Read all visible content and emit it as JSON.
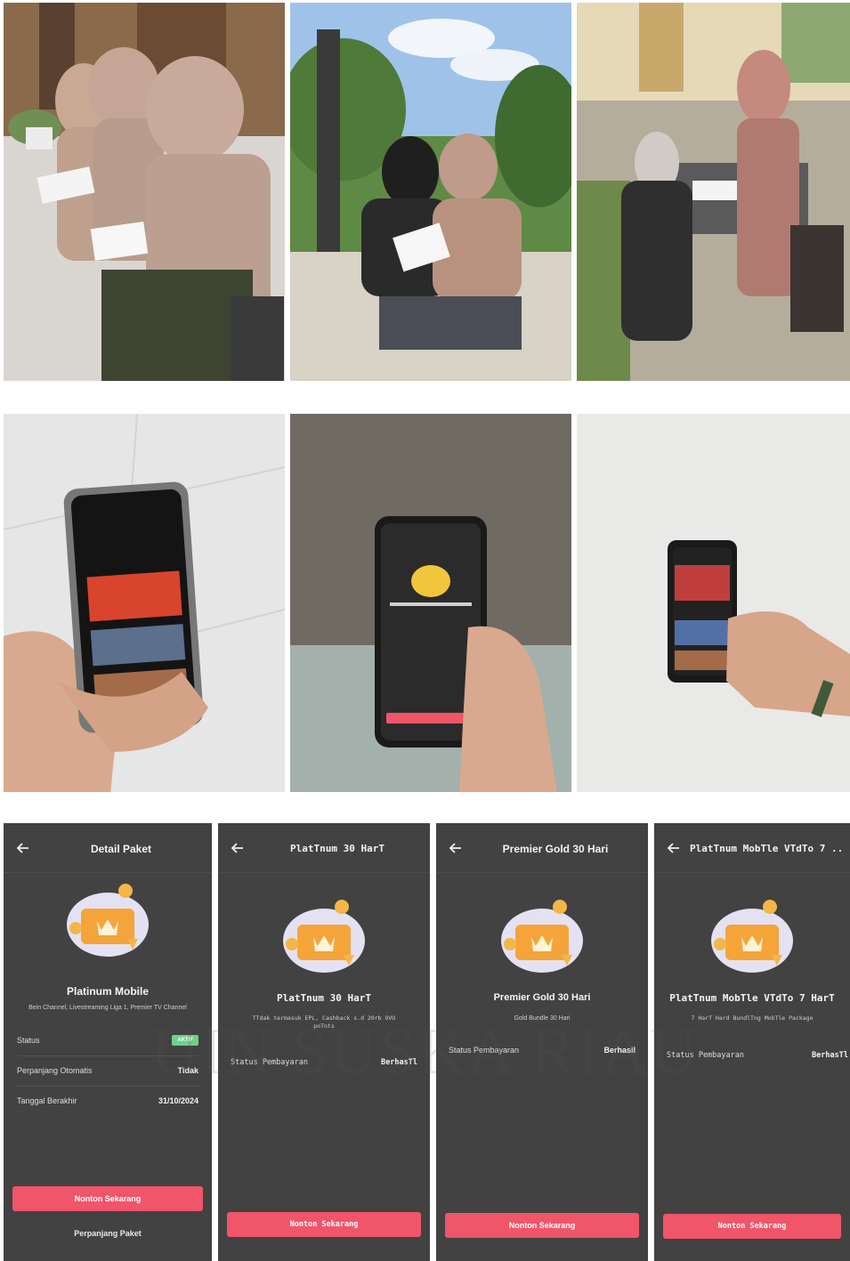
{
  "detail_paket": {
    "title": "Detail Paket",
    "package_name": "Platinum Mobile",
    "description": "Bein Channel, Livestreaming Liga 1, Premier TV Channel",
    "rows": [
      {
        "label": "Status",
        "value": "AKTIF"
      },
      {
        "label": "Perpanjang Otomatis",
        "value": "Tidak"
      },
      {
        "label": "Tanggal Berakhir",
        "value": "31/10/2024"
      }
    ],
    "primary_button": "Nonton Sekarang",
    "secondary_link": "Perpanjang Paket"
  },
  "platinum_30": {
    "title": "PlatTnum 30 HarT",
    "package_name": "PlatTnum 30 HarT",
    "description": "TTdak termasuk EPL, Cashback s.d 20rb OVO poTnts",
    "status_label": "Status Pembayaran",
    "status_value": "BerhasTl",
    "button": "Nonton Sekarang"
  },
  "premier_gold": {
    "title": "Premier Gold 30 Hari",
    "package_name": "Premier Gold 30 Hari",
    "description": "Gold Bundle 30 Hari",
    "status_label": "Status Pembayaran",
    "status_value": "Berhasil",
    "button": "Nonton Sekarang"
  },
  "platinum_vidio_7": {
    "title": "PlatTnum MobTle VTdTo 7 ...",
    "package_name": "PlatTnum MobTle VTdTo 7 HarT",
    "description": "7 HarT Hard BundlTng MobTle Package",
    "status_label": "Status Pembayaran",
    "status_value": "BerhasTl",
    "button": "Nonton Sekarang"
  },
  "watermark": "UIN SUSKA RIAU",
  "colors": {
    "panel_bg": "#424242",
    "accent_button": "#f0556a",
    "status_active": "#6fd08a",
    "illustration_card": "#f5a43a"
  },
  "icons": {
    "back": "arrow-left-icon",
    "illustration": "crown-card-illustration"
  }
}
